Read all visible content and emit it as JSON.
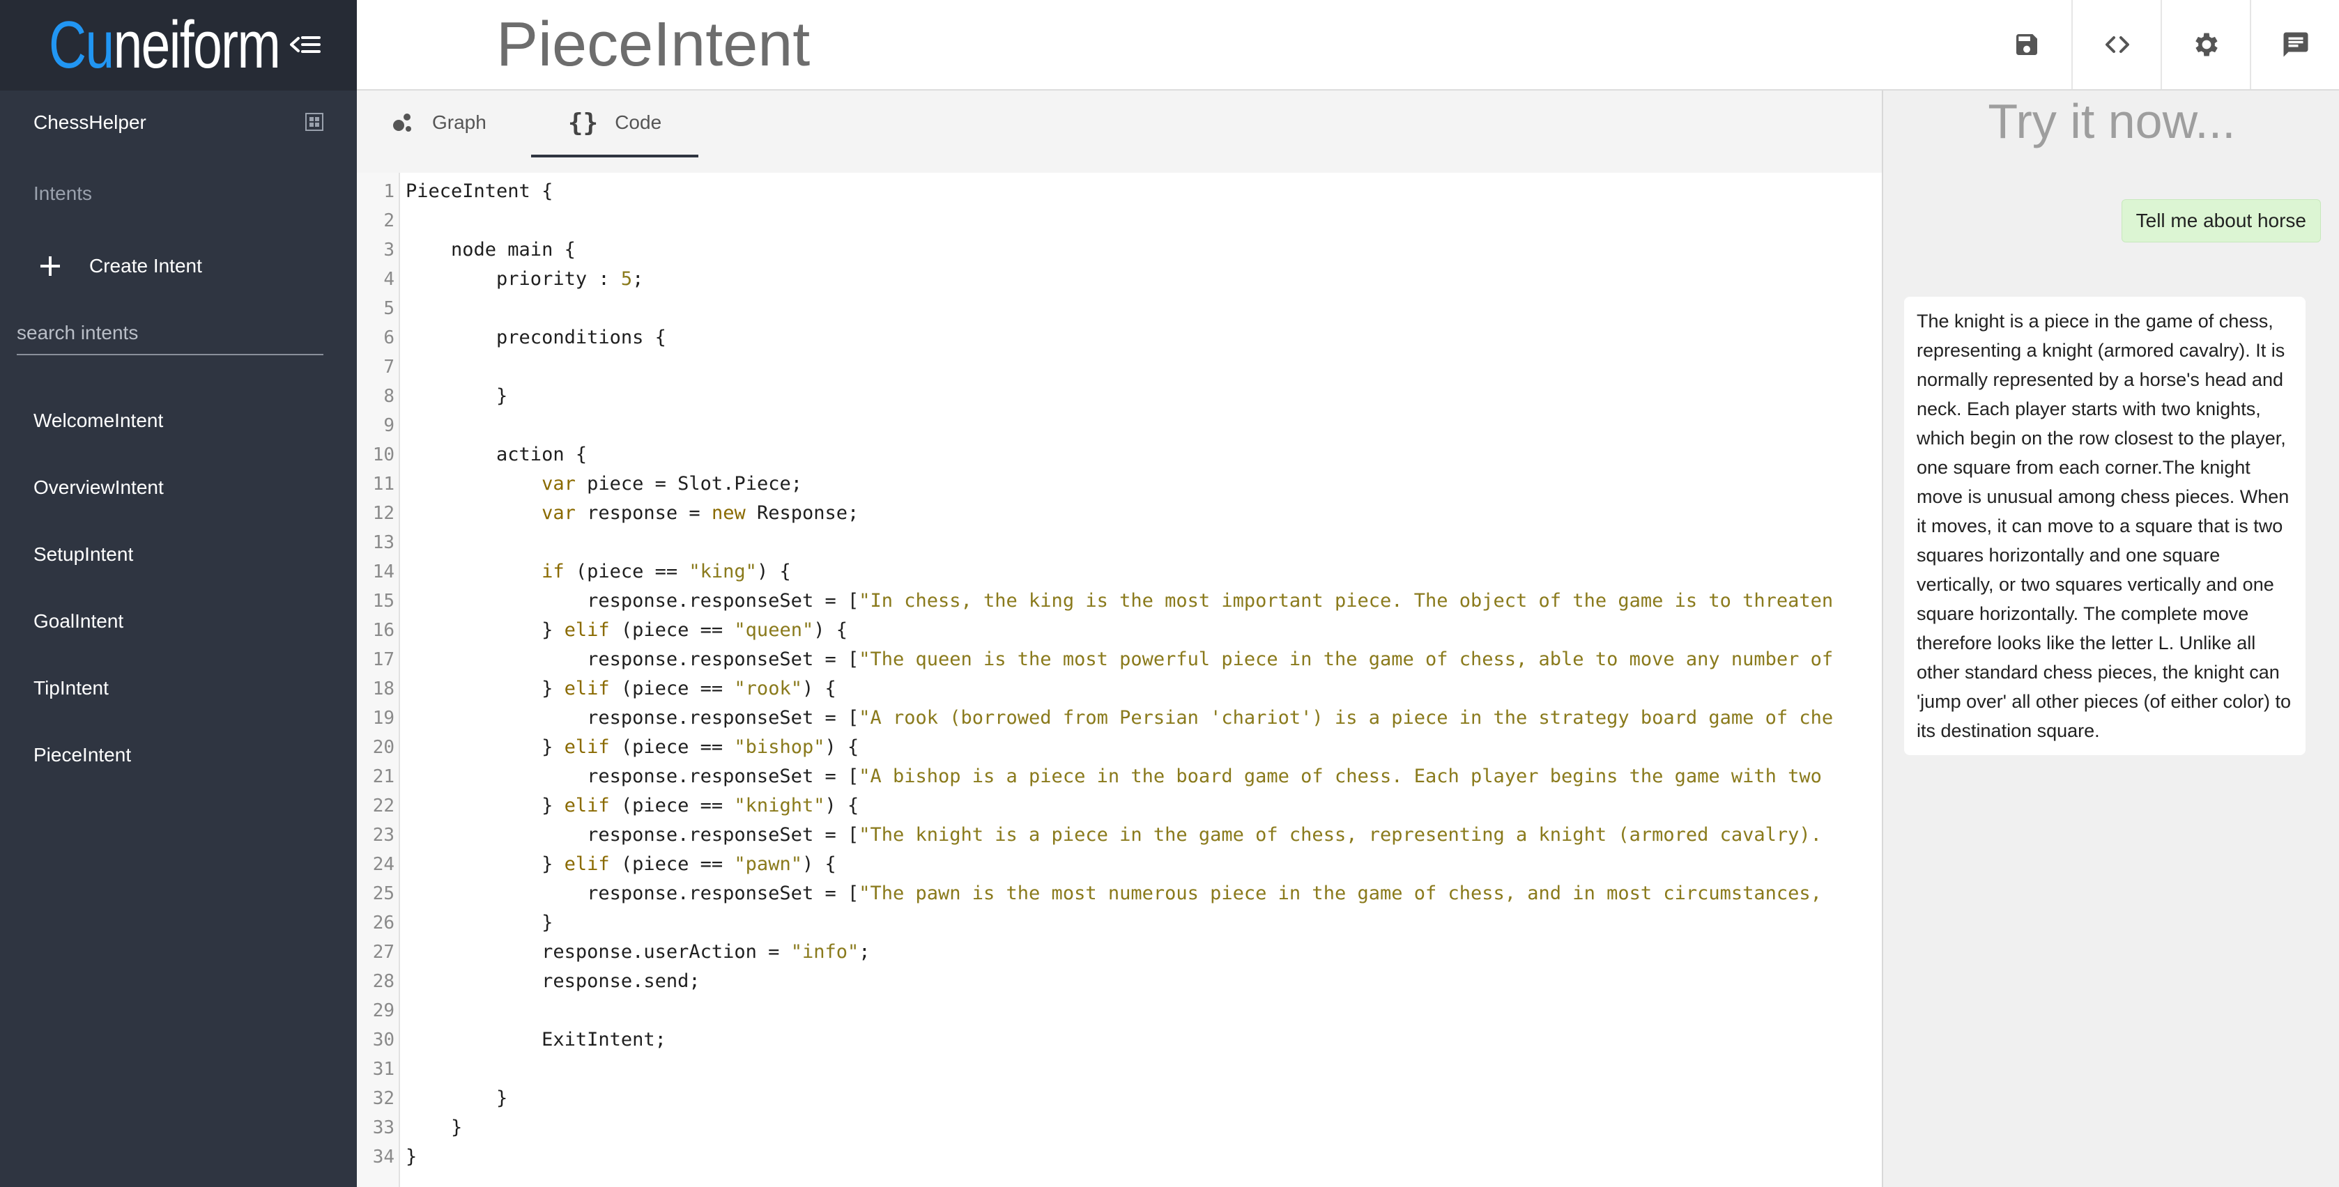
{
  "sidebar": {
    "logo_prefix": "Cu",
    "logo_rest": "neiform",
    "project_name": "ChessHelper",
    "section_label": "Intents",
    "create_intent_label": "Create Intent",
    "search_placeholder": "search intents",
    "intents": [
      "WelcomeIntent",
      "OverviewIntent",
      "SetupIntent",
      "GoalIntent",
      "TipIntent",
      "PieceIntent"
    ]
  },
  "header": {
    "title": "PieceIntent"
  },
  "tabs": [
    {
      "label": "Graph",
      "active": false
    },
    {
      "label": "Code",
      "active": true
    }
  ],
  "code_lines": [
    "PieceIntent {",
    "",
    "    node main {",
    "        priority : 5;",
    "",
    "        preconditions {",
    "",
    "        }",
    "",
    "        action {",
    "            var piece = Slot.Piece;",
    "            var response = new Response;",
    "",
    "            if (piece == \"king\") {",
    "                response.responseSet = [\"In chess, the king is the most important piece. The object of the game is to threaten",
    "            } elif (piece == \"queen\") {",
    "                response.responseSet = [\"The queen is the most powerful piece in the game of chess, able to move any number of",
    "            } elif (piece == \"rook\") {",
    "                response.responseSet = [\"A rook (borrowed from Persian 'chariot') is a piece in the strategy board game of che",
    "            } elif (piece == \"bishop\") {",
    "                response.responseSet = [\"A bishop is a piece in the board game of chess. Each player begins the game with two",
    "            } elif (piece == \"knight\") {",
    "                response.responseSet = [\"The knight is a piece in the game of chess, representing a knight (armored cavalry).",
    "            } elif (piece == \"pawn\") {",
    "                response.responseSet = [\"The pawn is the most numerous piece in the game of chess, and in most circumstances,",
    "            }",
    "            response.userAction = \"info\";",
    "            response.send;",
    "",
    "            ExitIntent;",
    "",
    "        }",
    "    }",
    "}"
  ],
  "chat": {
    "title": "Try it now...",
    "user_message": "Tell me about horse",
    "bot_message": "The knight is a piece in the game of chess, representing a knight (armored cavalry). It is normally represented by a horse's head and neck. Each player starts with two knights, which begin on the row closest to the player, one square from each corner.The knight move is unusual among chess pieces. When it moves, it can move to a square that is two squares horizontally and one square vertically, or two squares vertically and one square horizontally. The complete move therefore looks like the letter L. Unlike all other standard chess pieces, the knight can 'jump over' all other pieces (of either color) to its destination square."
  },
  "colors": {
    "sidebar_bg": "#2f3541",
    "logo_accent": "#2196f3",
    "user_bubble": "#dcf5d3",
    "keyword": "#8a6a00",
    "string": "#8a7a1c"
  },
  "icons": {
    "collapse": "menu-collapse-icon",
    "project": "project-grid-icon",
    "create": "plus-icon",
    "graph_tab": "graph-dots-icon",
    "code_tab": "braces-icon",
    "save": "save-icon",
    "code_view": "code-icon",
    "settings": "gear-icon",
    "chat": "chat-icon"
  }
}
